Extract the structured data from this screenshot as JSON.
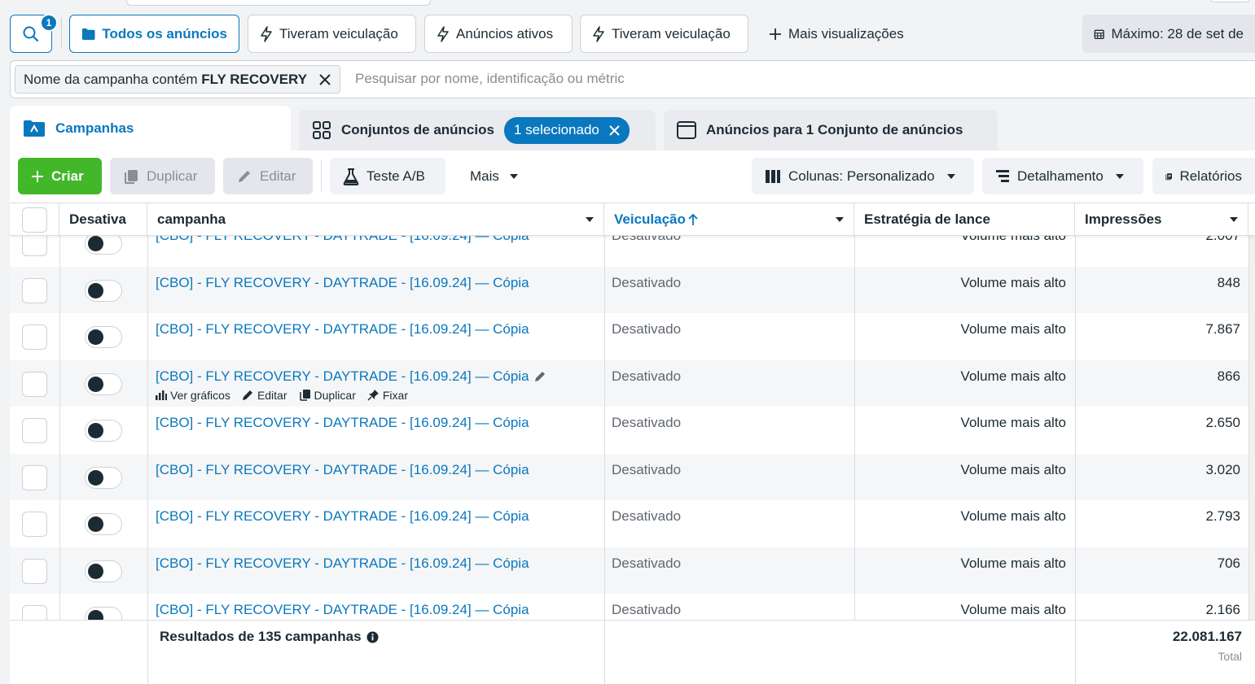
{
  "top_chips": {
    "search_badge": "1",
    "all_ads": "Todos os anúncios",
    "had_delivery_1": "Tiveram veiculação",
    "active_ads": "Anúncios ativos",
    "had_delivery_2": "Tiveram veiculação",
    "more_views": "Mais visualizações",
    "date_range": "Máximo: 28 de set de"
  },
  "filter": {
    "token_prefix": "Nome da campanha contém",
    "token_value": "FLY RECOVERY",
    "search_placeholder": "Pesquisar por nome, identificação ou métric"
  },
  "tabs": {
    "campaigns": "Campanhas",
    "ad_sets": "Conjuntos de anúncios",
    "selected": "1 selecionado",
    "ads": "Anúncios para 1 Conjunto de anúncios"
  },
  "toolbar": {
    "create": "Criar",
    "duplicate": "Duplicar",
    "edit": "Editar",
    "ab_test": "Teste A/B",
    "more": "Mais",
    "columns": "Colunas: Personalizado",
    "breakdown": "Detalhamento",
    "reports": "Relatórios"
  },
  "table": {
    "headers": {
      "toggle": "Desativa",
      "campaign": "campanha",
      "delivery": "Veiculação",
      "bid_strategy": "Estratégia de lance",
      "impressions": "Impressões"
    },
    "row_actions": {
      "charts": "Ver gráficos",
      "edit": "Editar",
      "duplicate": "Duplicar",
      "pin": "Fixar"
    },
    "rows": [
      {
        "name": "[CBO] - FLY RECOVERY - DAYTRADE - [16.09.24] — Cópia",
        "delivery": "Desativado",
        "bid": "Volume mais alto",
        "impressions": "2.007"
      },
      {
        "name": "[CBO] - FLY RECOVERY - DAYTRADE - [16.09.24] — Cópia",
        "delivery": "Desativado",
        "bid": "Volume mais alto",
        "impressions": "848"
      },
      {
        "name": "[CBO] - FLY RECOVERY - DAYTRADE - [16.09.24] — Cópia",
        "delivery": "Desativado",
        "bid": "Volume mais alto",
        "impressions": "7.867"
      },
      {
        "name": "[CBO] - FLY RECOVERY - DAYTRADE - [16.09.24] — Cópia",
        "delivery": "Desativado",
        "bid": "Volume mais alto",
        "impressions": "866"
      },
      {
        "name": "[CBO] - FLY RECOVERY - DAYTRADE - [16.09.24] — Cópia",
        "delivery": "Desativado",
        "bid": "Volume mais alto",
        "impressions": "2.650"
      },
      {
        "name": "[CBO] - FLY RECOVERY - DAYTRADE - [16.09.24] — Cópia",
        "delivery": "Desativado",
        "bid": "Volume mais alto",
        "impressions": "3.020"
      },
      {
        "name": "[CBO] - FLY RECOVERY - DAYTRADE - [16.09.24] — Cópia",
        "delivery": "Desativado",
        "bid": "Volume mais alto",
        "impressions": "2.793"
      },
      {
        "name": "[CBO] - FLY RECOVERY - DAYTRADE - [16.09.24] — Cópia",
        "delivery": "Desativado",
        "bid": "Volume mais alto",
        "impressions": "706"
      },
      {
        "name": "[CBO] - FLY RECOVERY - DAYTRADE - [16.09.24] — Cópia",
        "delivery": "Desativado",
        "bid": "Volume mais alto",
        "impressions": "2.166"
      }
    ]
  },
  "footer": {
    "results": "Resultados de 135 campanhas",
    "total_value": "22.081.167",
    "total_label": "Total"
  },
  "colors": {
    "accent": "#0a78be",
    "create_green": "#42b72a"
  }
}
